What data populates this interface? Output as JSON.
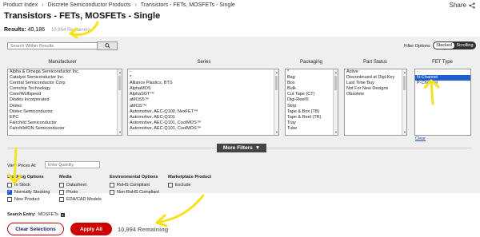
{
  "breadcrumb": [
    "Product Index",
    "Discrete Semiconductor Products",
    "Transistors - FETs, MOSFETs - Single"
  ],
  "share_label": "Share",
  "page_title": "Transistors - FETs, MOSFETs - Single",
  "results": {
    "label": "Results:",
    "count": "40,186",
    "remaining": "10,994 Remaining"
  },
  "search": {
    "placeholder": "Search Within Results"
  },
  "filter_options": {
    "label": "Filter Options",
    "toggle": [
      "Stacked",
      "Scrolling"
    ],
    "active": "Stacked"
  },
  "columns": [
    {
      "header": "Manufacturer",
      "items": [
        "Alpha & Omega Semiconductor Inc.",
        "Catalyst Semiconductor Inc.",
        "Central Semiconductor Corp",
        "Comchip Technology",
        "Cree/Wolfspeed",
        "Diodes Incorporated",
        "Diotec",
        "Diotec Semiconductor",
        "EPC",
        "Fairchild Semiconductor",
        "Fairchild/ON Semiconductor"
      ],
      "selected": []
    },
    {
      "header": "Series",
      "items": [
        "-",
        "*",
        "Alliance Plastics, BTS",
        "AlphaMOS",
        "AlphaSGT™",
        "aMOS5™",
        "aMOS™",
        "Automotive, AEC-Q100, NexFET™",
        "Automotive, AEC-Q101",
        "Automotive, AEC-Q101, CoolMOS™",
        "Automotive, AEC-Q101, CoolMOS™"
      ],
      "selected": []
    },
    {
      "header": "Packaging",
      "items": [
        "*",
        "Bag",
        "Box",
        "Bulk",
        "Cut Tape (CT)",
        "Digi-Reel®",
        "Strip",
        "Tape & Box (TB)",
        "Tape & Reel (TR)",
        "Tray",
        "Tube"
      ],
      "selected": []
    },
    {
      "header": "Part Status",
      "items": [
        "Active",
        "Discontinued at Digi-Key",
        "Last Time Buy",
        "Not For New Designs",
        "Obsolete"
      ],
      "selected": []
    },
    {
      "header": "FET Type",
      "items": [
        "-",
        "N-Channel",
        "P-Channel"
      ],
      "selected": [
        1
      ]
    }
  ],
  "clear_label": "Clear",
  "more_filters_label": "More Filters",
  "view_prices": {
    "label": "View Prices At:",
    "placeholder": "Enter Quantity"
  },
  "groups": [
    {
      "title": "Stocking Options",
      "options": [
        {
          "label": "In Stock",
          "checked": false
        },
        {
          "label": "Normally Stocking",
          "checked": true
        },
        {
          "label": "New Product",
          "checked": false
        }
      ]
    },
    {
      "title": "Media",
      "options": [
        {
          "label": "Datasheet",
          "checked": false
        },
        {
          "label": "Photo",
          "checked": false
        },
        {
          "label": "EDA/CAD Models",
          "checked": false
        }
      ]
    },
    {
      "title": "Environmental Options",
      "options": [
        {
          "label": "RoHS Compliant",
          "checked": false
        },
        {
          "label": "Non-RoHS Compliant",
          "checked": false
        }
      ]
    },
    {
      "title": "Marketplace Product",
      "options": [
        {
          "label": "Exclude",
          "checked": false
        }
      ]
    }
  ],
  "search_entry": {
    "label": "Search Entry:",
    "tag": "MOSFETs"
  },
  "buttons": {
    "clear": "Clear Selections",
    "apply": "Apply All"
  },
  "remaining_bottom": "10,994 Remaining",
  "colors": {
    "accent_red": "#cc0000",
    "selection_blue": "#1e5fd0",
    "annotation_yellow": "#f6e21b"
  }
}
